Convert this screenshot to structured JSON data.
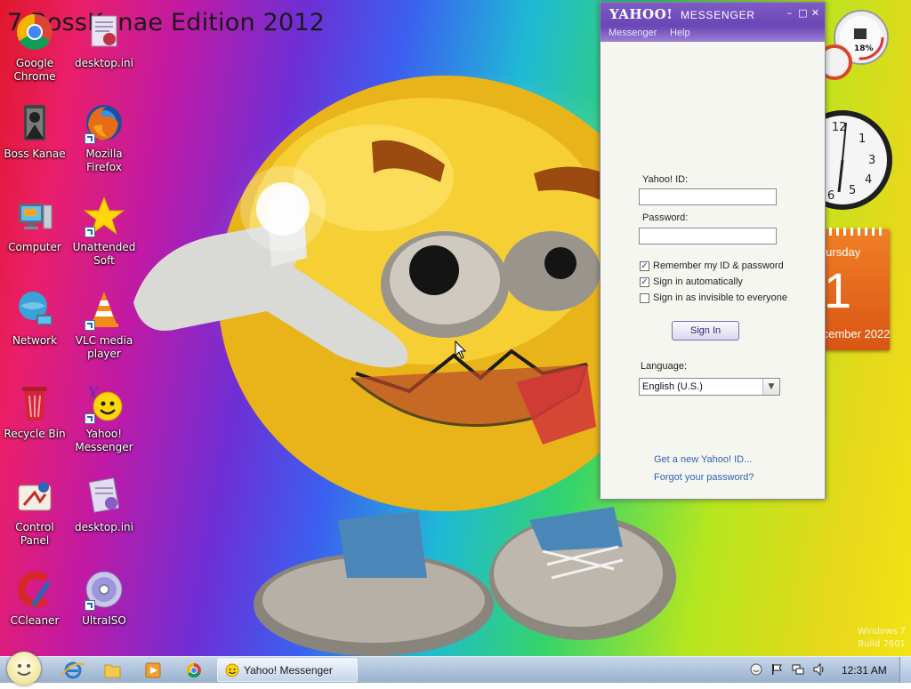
{
  "wallpaper": {
    "title": "7 BossKanae Edition 2012",
    "watermark_line1": "Windows 7",
    "watermark_line2": "Build 7601"
  },
  "desktop_icons": [
    {
      "label": "Google Chrome",
      "icon": "chrome-icon"
    },
    {
      "label": "desktop.ini",
      "icon": "ini-file-icon"
    },
    {
      "label": "Boss Kanae",
      "icon": "boss-kanae-icon"
    },
    {
      "label": "Mozilla Firefox",
      "icon": "firefox-icon"
    },
    {
      "label": "Computer",
      "icon": "computer-icon"
    },
    {
      "label": "Unattended Soft",
      "icon": "star-icon"
    },
    {
      "label": "Network",
      "icon": "network-icon"
    },
    {
      "label": "VLC media player",
      "icon": "vlc-icon"
    },
    {
      "label": "Recycle Bin",
      "icon": "recycle-bin-icon"
    },
    {
      "label": "Yahoo! Messenger",
      "icon": "yahoo-messenger-icon"
    },
    {
      "label": "Control Panel",
      "icon": "control-panel-icon"
    },
    {
      "label": "desktop.ini",
      "icon": "ini-file-icon"
    },
    {
      "label": "CCleaner",
      "icon": "ccleaner-icon"
    },
    {
      "label": "UltraISO",
      "icon": "ultraiso-icon"
    }
  ],
  "gadgets": {
    "cpu_meter_percent": "18%",
    "calendar_day_name": "Thursday",
    "calendar_day": "1",
    "calendar_month_year": "December 2022"
  },
  "messenger": {
    "logo": "YAHOO!",
    "logo_sub": "MESSENGER",
    "menu": [
      "Messenger",
      "Help"
    ],
    "id_label": "Yahoo! ID:",
    "id_value": "",
    "password_label": "Password:",
    "password_value": "",
    "remember_label": "Remember my ID & password",
    "remember_checked": true,
    "auto_label": "Sign in automatically",
    "auto_checked": true,
    "invisible_label": "Sign in as invisible to everyone",
    "invisible_checked": false,
    "sign_in": "Sign In",
    "language_label": "Language:",
    "language_value": "English (U.S.)",
    "new_id_link": "Get a new Yahoo! ID...",
    "forgot_link": "Forgot your password?",
    "check_mark": "✓"
  },
  "taskbar": {
    "active_task": "Yahoo! Messenger",
    "clock": "12:31 AM",
    "pinned": [
      "internet-explorer-icon",
      "folder-icon",
      "media-player-icon",
      "chrome-icon"
    ]
  },
  "colors": {
    "ym_purple": "#6a46b6",
    "link_blue": "#2f63b5",
    "calendar_orange": "#e8671a"
  }
}
